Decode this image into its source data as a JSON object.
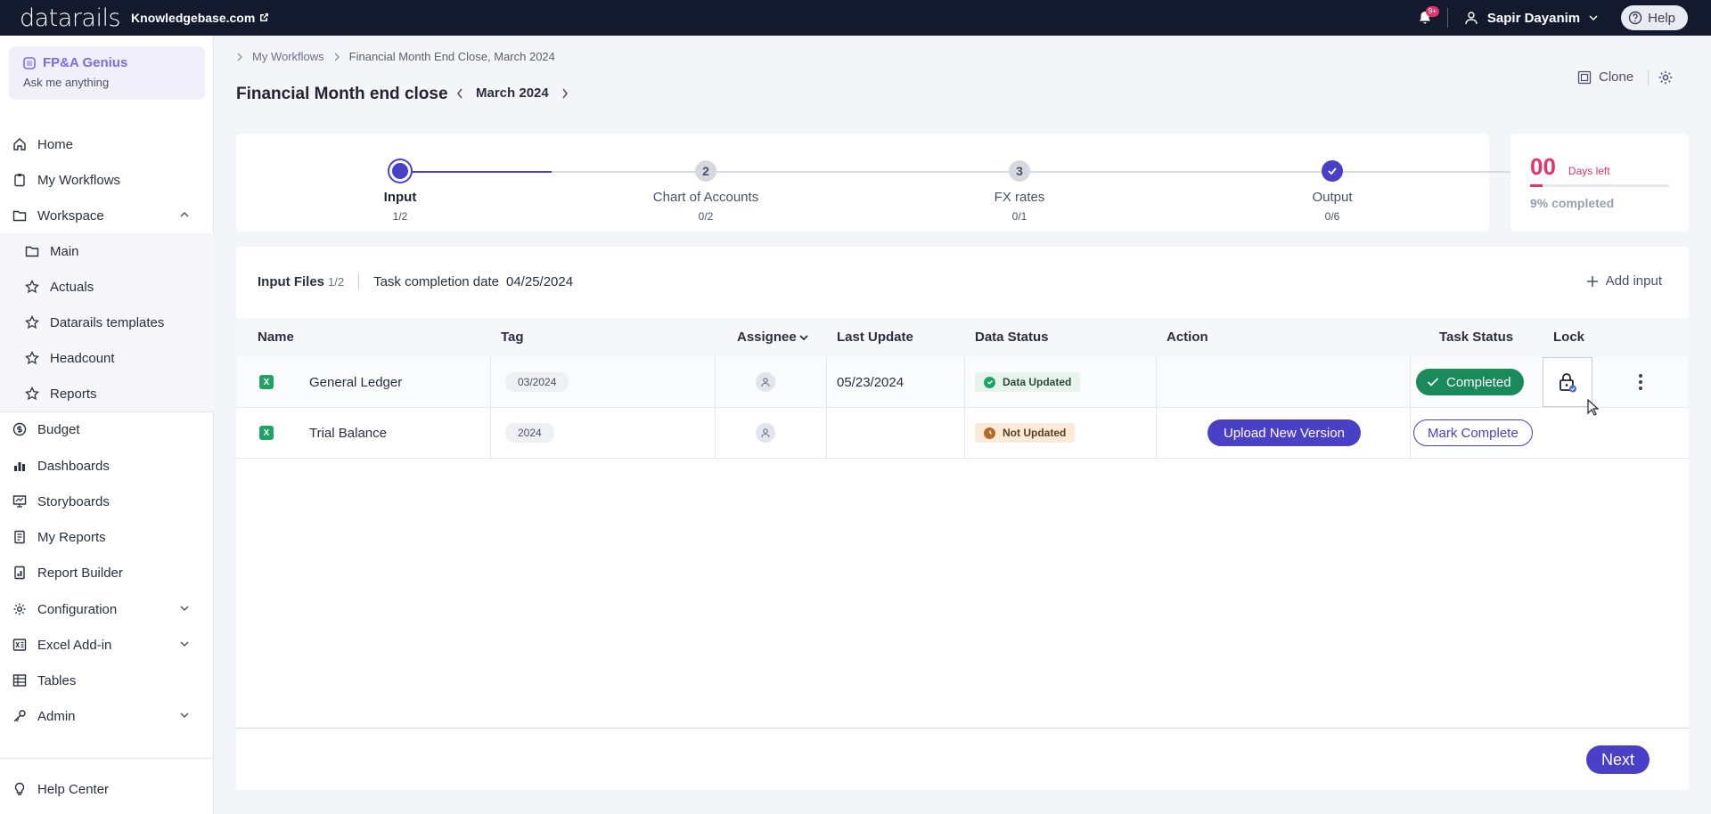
{
  "topbar": {
    "logo": "datarails",
    "site": "Knowledgebase.com",
    "notification_badge": "9+",
    "user_name": "Sapir Dayanim",
    "help_label": "Help"
  },
  "genius": {
    "title": "FP&A Genius",
    "subtitle": "Ask me anything"
  },
  "sidebar": {
    "items": [
      {
        "label": "Home",
        "icon": "home-icon"
      },
      {
        "label": "My Workflows",
        "icon": "clipboard-icon"
      },
      {
        "label": "Workspace",
        "icon": "folder-icon"
      },
      {
        "label": "Main",
        "icon": "folder-icon"
      },
      {
        "label": "Actuals",
        "icon": "star-icon"
      },
      {
        "label": "Datarails templates",
        "icon": "star-icon"
      },
      {
        "label": "Headcount",
        "icon": "star-icon"
      },
      {
        "label": "Reports",
        "icon": "star-icon"
      },
      {
        "label": "Budget",
        "icon": "dollar-icon"
      },
      {
        "label": "Dashboards",
        "icon": "bar-chart-icon"
      },
      {
        "label": "Storyboards",
        "icon": "presentation-icon"
      },
      {
        "label": "My Reports",
        "icon": "report-icon"
      },
      {
        "label": "Report Builder",
        "icon": "report-builder-icon"
      },
      {
        "label": "Configuration",
        "icon": "gear-icon"
      },
      {
        "label": "Excel Add-in",
        "icon": "excel-icon"
      },
      {
        "label": "Tables",
        "icon": "table-icon"
      },
      {
        "label": "Admin",
        "icon": "key-icon"
      }
    ],
    "help_center": "Help Center"
  },
  "breadcrumb": {
    "parent": "My Workflows",
    "current": "Financial Month End Close, March 2024"
  },
  "page": {
    "title": "Financial Month end close",
    "period": "March 2024",
    "clone_label": "Clone"
  },
  "steps": [
    {
      "label": "Input",
      "count": "1/2",
      "marker": ""
    },
    {
      "label": "Chart of Accounts",
      "count": "0/2",
      "marker": "2"
    },
    {
      "label": "FX rates",
      "count": "0/1",
      "marker": "3"
    },
    {
      "label": "Output",
      "count": "0/6",
      "marker": ""
    }
  ],
  "days": {
    "number": "00",
    "label": "Days left",
    "completed_text": "9% completed",
    "completed_fraction": 0.09
  },
  "files": {
    "title": "Input Files",
    "count": "1/2",
    "completion_label": "Task completion date",
    "completion_date": "04/25/2024",
    "add_input_label": "Add input"
  },
  "table": {
    "columns": [
      "Name",
      "Tag",
      "Assignee",
      "Last Update",
      "Data Status",
      "Action",
      "Task Status",
      "Lock"
    ],
    "rows": [
      {
        "name": "General Ledger",
        "tag": "03/2024",
        "last_update": "05/23/2024",
        "data_status": "Data Updated",
        "action": "",
        "task_status": "Completed"
      },
      {
        "name": "Trial Balance",
        "tag": "2024",
        "last_update": "",
        "data_status": "Not Updated",
        "action": "Upload New Version",
        "task_status": "Mark Complete"
      }
    ]
  },
  "footer": {
    "next_label": "Next"
  },
  "colors": {
    "primary": "#4a3fc7",
    "topbar": "#131a2e",
    "danger": "#e2336b",
    "success": "#1a8a5a"
  }
}
